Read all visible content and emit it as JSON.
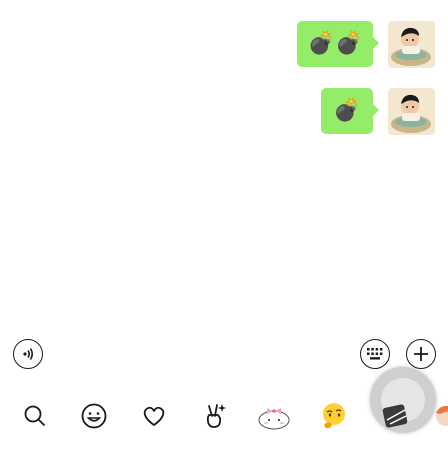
{
  "colors": {
    "bubble": "#95ec69",
    "icon_stroke": "#191919"
  },
  "messages": [
    {
      "sender": "me",
      "content": "💣💣",
      "avatar": "cartoon-child-avatar"
    },
    {
      "sender": "me",
      "content": "💣",
      "avatar": "cartoon-child-avatar"
    }
  ],
  "input_bar": {
    "voice_icon": "voice-icon",
    "keyboard_icon": "keyboard-icon",
    "plus_icon": "plus-icon"
  },
  "emoji_panel": {
    "items": [
      {
        "name": "search-icon",
        "selected": false
      },
      {
        "name": "smiley-icon",
        "selected": false
      },
      {
        "name": "heart-icon",
        "selected": false
      },
      {
        "name": "victory-hand-icon",
        "selected": false
      },
      {
        "name": "cute-blob-sticker-icon",
        "selected": false
      },
      {
        "name": "thinking-face-sticker-icon",
        "selected": false
      },
      {
        "name": "sticker-pack-icon",
        "selected": true
      },
      {
        "name": "cartoon-sticker-icon",
        "selected": false
      }
    ]
  }
}
